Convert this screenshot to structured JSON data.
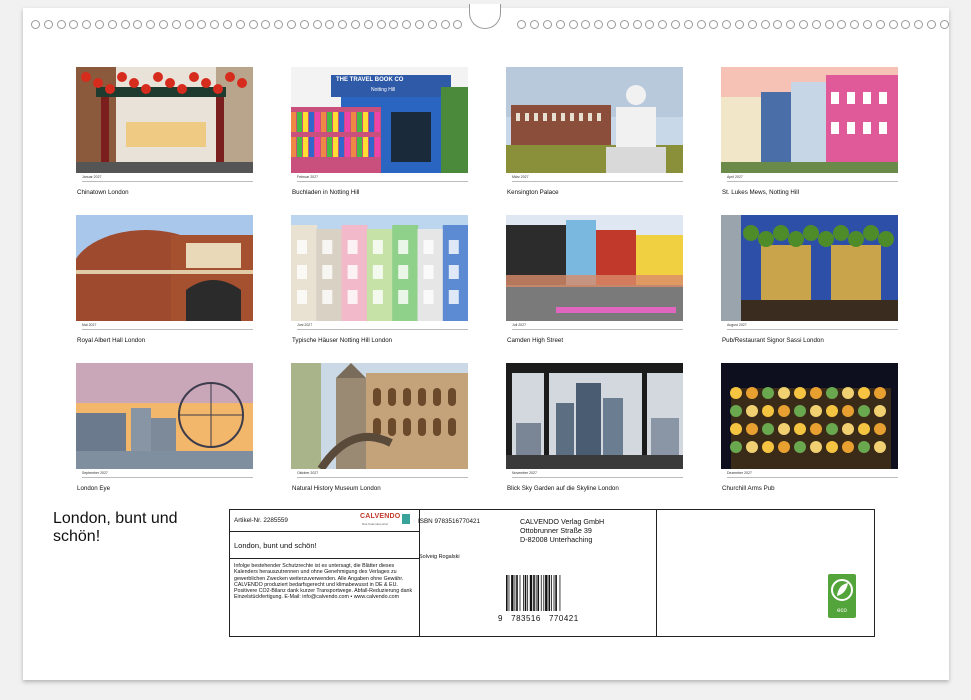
{
  "months": [
    {
      "label": "Januar 2027",
      "caption": "Chinatown London",
      "icon": "chinatown-photo"
    },
    {
      "label": "Februar 2027",
      "caption": "Buchladen in Notting Hill",
      "icon": "bookshop-photo",
      "sign": "THE TRAVEL BOOK CO",
      "sign2": "Notting Hill"
    },
    {
      "label": "März 2027",
      "caption": "Kensington Palace",
      "icon": "palace-photo"
    },
    {
      "label": "April 2027",
      "caption": "St. Lukes Mews, Notting Hill",
      "icon": "mews-photo"
    },
    {
      "label": "Mai 2027",
      "caption": "Royal Albert Hall London",
      "icon": "albert-hall-photo"
    },
    {
      "label": "Juni 2027",
      "caption": "Typische Häuser Notting Hill London",
      "icon": "colorful-houses-photo"
    },
    {
      "label": "Juli 2027",
      "caption": "Camden High Street",
      "icon": "camden-photo"
    },
    {
      "label": "August 2027",
      "caption": "Pub/Restaurant Signor Sassi London",
      "icon": "pub-photo"
    },
    {
      "label": "September 2027",
      "caption": "London Eye",
      "icon": "london-eye-photo"
    },
    {
      "label": "Oktober 2027",
      "caption": "Natural History Museum London",
      "icon": "museum-photo"
    },
    {
      "label": "November 2027",
      "caption": "Blick Sky Garden auf die Skyline London",
      "icon": "skyline-photo"
    },
    {
      "label": "Dezember 2027",
      "caption": "Churchill Arms Pub",
      "icon": "churchill-pub-photo"
    }
  ],
  "title": "London, bunt und schön!",
  "info": {
    "article": "Artikel-Nr. 2285559",
    "brand": "CALVENDO",
    "brand_sub": "Das Kalenderportal",
    "title": "London, bunt und schön!",
    "legal": "Infolge bestehender Schutzrechte ist es untersagt, die Blätter dieses Kalenders herauszutrennen und ohne Genehmigung des Verlages zu gewerblichen Zwecken weiterzuverwenden. Alle Angaben ohne Gewähr. CALVENDO produziert bedarfsgerecht und klimabewusst in DE & EU. Positivere CO2-Bilanz dank kurzer Transportwege. Abfall-Reduzierung dank Einzelstückfertigung. E-Mail: info@calvendo.com • www.calvendo.com",
    "isbn": "ISBN 9783516770421",
    "publisher1": "CALVENDO Verlag GmbH",
    "publisher2": "Ottobrunner Straße 39",
    "publisher3": "D-82008 Unterhaching",
    "author": "Solveig Rogalski",
    "barcode_digits": "9   783516   770421",
    "eco_label": "eco"
  }
}
